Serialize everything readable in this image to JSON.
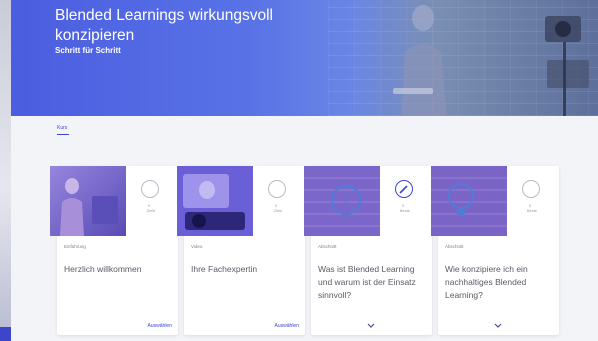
{
  "hero": {
    "title": "Blended Learnings wirkungsvoll konzipieren",
    "subtitle": "Schritt für Schritt"
  },
  "tabs": [
    {
      "label": "Kurs",
      "active": true
    }
  ],
  "cards": [
    {
      "category": "Einführung",
      "title": "Herzlich willkommen",
      "status_dot": "0",
      "status_label": "Ziele",
      "completed": false,
      "action": "Auswählen",
      "thumb_icon": "presenter-photo"
    },
    {
      "category": "Video",
      "title": "Ihre Fachexpertin",
      "status_dot": "0",
      "status_label": "Ziele",
      "completed": false,
      "action": "Auswählen",
      "thumb_icon": "camera-recording-photo"
    },
    {
      "category": "Abschnitt",
      "title": "Was ist Blended Learning und warum ist der Einsatz sinnvoll?",
      "status_dot": "0",
      "status_label": "Beste",
      "completed": true,
      "action": "",
      "thumb_icon": "question-bubble-icon"
    },
    {
      "category": "Abschnitt",
      "title": "Wie konzipiere ich ein nachhaltiges Blended Learning?",
      "status_dot": "0",
      "status_label": "Beste",
      "completed": false,
      "action": "",
      "thumb_icon": "lightbulb-icon"
    }
  ],
  "colors": {
    "accent": "#3d46c9",
    "hero_start": "#4b5de0",
    "thumb_video": "#6a5fd6",
    "thumb_section": "#7b66c9"
  }
}
